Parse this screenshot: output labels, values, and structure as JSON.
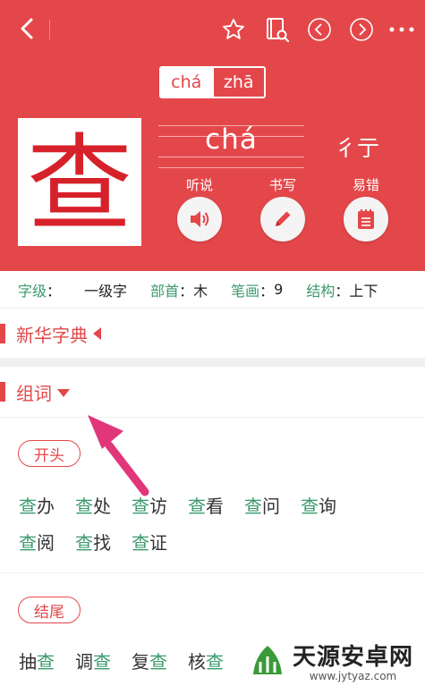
{
  "header": {
    "pinyin_options": [
      "chá",
      "zhā"
    ],
    "character": "查",
    "pinyin": "chá",
    "radicals": "彳亍",
    "actions": [
      {
        "label": "听说",
        "icon": "speaker-icon"
      },
      {
        "label": "书写",
        "icon": "pencil-icon"
      },
      {
        "label": "易错",
        "icon": "notepad-icon"
      }
    ]
  },
  "info": {
    "level_key": "字级",
    "level_val": "一级字",
    "radical_key": "部首",
    "radical_val": "木",
    "strokes_key": "笔画",
    "strokes_val": "9",
    "structure_key": "结构",
    "structure_val": "上下",
    "sep": "："
  },
  "sections": {
    "dictionary_title": "新华字典",
    "words_title": "组词"
  },
  "start_group": {
    "label": "开头",
    "words": [
      [
        "查",
        "办"
      ],
      [
        "查",
        "处"
      ],
      [
        "查",
        "访"
      ],
      [
        "查",
        "看"
      ],
      [
        "查",
        "问"
      ],
      [
        "查",
        "询"
      ],
      [
        "查",
        "阅"
      ],
      [
        "查",
        "找"
      ],
      [
        "查",
        "证"
      ]
    ]
  },
  "end_group": {
    "label": "结尾",
    "words": [
      [
        "抽",
        "查"
      ],
      [
        "调",
        "查"
      ],
      [
        "复",
        "查"
      ],
      [
        "核",
        "查"
      ]
    ]
  },
  "watermark": {
    "brand": "天源安卓网",
    "url": "www.jytyaz.com"
  },
  "colors": {
    "primary_red": "#e4474a",
    "accent_green": "#3a9a6c"
  }
}
